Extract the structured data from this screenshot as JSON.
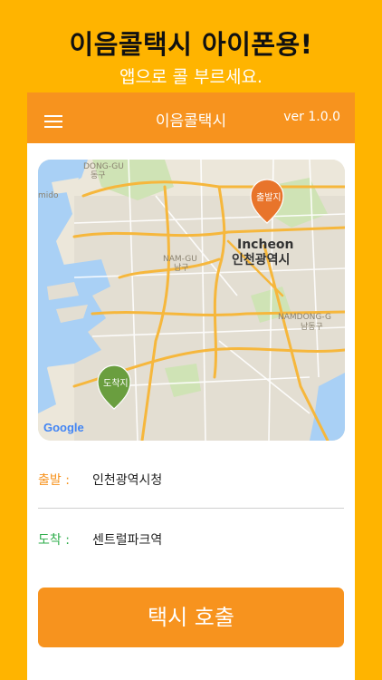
{
  "promo": {
    "title": "이음콜택시 아이폰용!",
    "subtitle": "앱으로 콜 부르세요."
  },
  "appbar": {
    "title": "이음콜택시",
    "version": "ver 1.0.0",
    "menu_icon": "hamburger-icon"
  },
  "map": {
    "labels": {
      "dong_gu_en": "DONG-GU",
      "dong_gu_ko": "동구",
      "mido": "mido",
      "nam_gu_en": "NAM-GU",
      "nam_gu_ko": "남구",
      "incheon_en": "Incheon",
      "incheon_ko": "인천광역시",
      "namdong_en": "NAMDONG-G",
      "namdong_ko": "남동구"
    },
    "origin_pin": "출발지",
    "destination_pin": "도착지",
    "attribution": "Google"
  },
  "form": {
    "origin_label": "출발 :",
    "origin_value": "인천광역시청",
    "destination_label": "도착 :",
    "destination_value": "센트럴파크역"
  },
  "call_button": "택시 호출",
  "colors": {
    "background": "#FFB400",
    "accent": "#F7931E",
    "origin_label": "#F7931E",
    "destination_label": "#2EAD4B",
    "destination_pin": "#6A9E3F"
  }
}
